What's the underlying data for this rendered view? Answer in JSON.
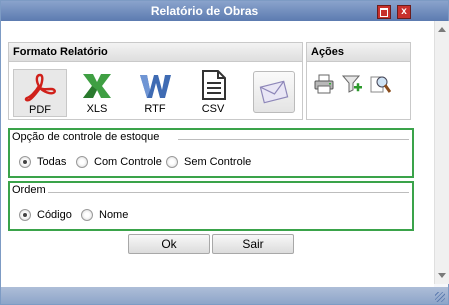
{
  "window": {
    "title": "Relatório de Obras"
  },
  "formato": {
    "header": "Formato Relatório",
    "items": [
      {
        "label": "PDF",
        "icon": "pdf-icon"
      },
      {
        "label": "XLS",
        "icon": "excel-icon"
      },
      {
        "label": "RTF",
        "icon": "word-icon"
      },
      {
        "label": "CSV",
        "icon": "csv-document-icon"
      }
    ],
    "email_icon": "email-envelope-icon"
  },
  "acoes": {
    "header": "Ações",
    "icons": [
      "printer-icon",
      "filter-add-icon",
      "magnify-preview-icon"
    ]
  },
  "estoque": {
    "legend": "Opção de controle de estoque",
    "options": [
      {
        "label": "Todas",
        "checked": true
      },
      {
        "label": "Com Controle",
        "checked": false
      },
      {
        "label": "Sem Controle",
        "checked": false
      }
    ]
  },
  "ordem": {
    "legend": "Ordem",
    "options": [
      {
        "label": "Código",
        "checked": true
      },
      {
        "label": "Nome",
        "checked": false
      }
    ]
  },
  "buttons": {
    "ok": "Ok",
    "sair": "Sair"
  },
  "colors": {
    "highlight_border": "#3aa34a",
    "titlebar": "#5c7bb0",
    "close_button": "#c8302c"
  }
}
